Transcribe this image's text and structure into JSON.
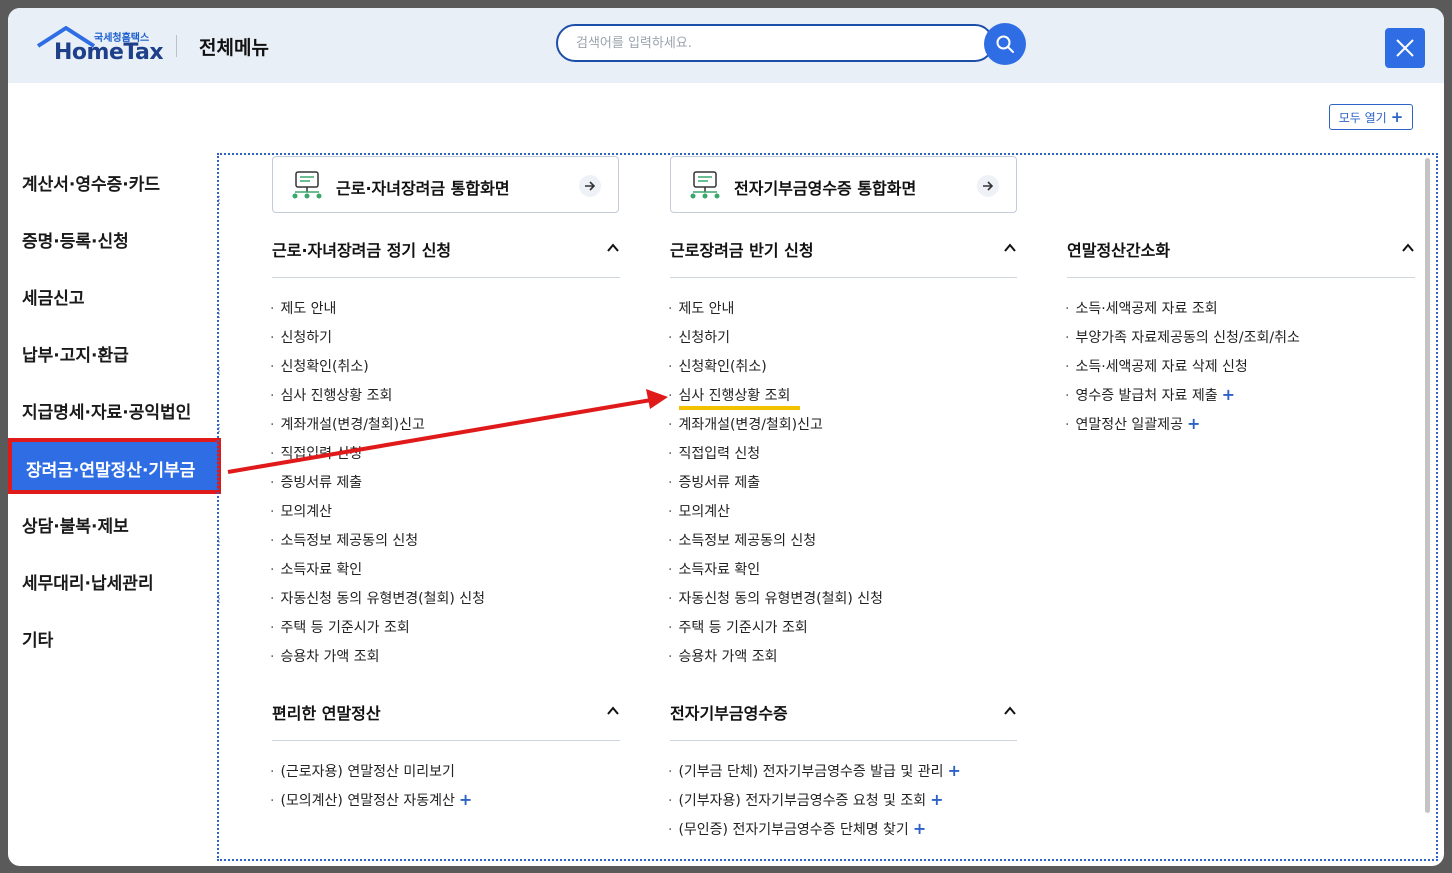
{
  "header": {
    "logo_sub": "국세청홈택스",
    "logo_main": "HomeTax",
    "title": "전체메뉴",
    "search_placeholder": "검색어를 입력하세요.",
    "expand_all_label": "모두 열기"
  },
  "sidebar": {
    "items": [
      {
        "label": "계산서·영수증·카드"
      },
      {
        "label": "증명·등록·신청"
      },
      {
        "label": "세금신고"
      },
      {
        "label": "납부·고지·환급"
      },
      {
        "label": "지급명세·자료·공익법인"
      },
      {
        "label": "장려금·연말정산·기부금",
        "active": true
      },
      {
        "label": "상담·불복·제보"
      },
      {
        "label": "세무대리·납세관리"
      },
      {
        "label": "기타"
      }
    ]
  },
  "cards": [
    {
      "label": "근로·자녀장려금 통합화면"
    },
    {
      "label": "전자기부금영수증 통합화면"
    }
  ],
  "sections": [
    {
      "title": "근로·자녀장려금 정기 신청",
      "links": [
        "제도 안내",
        "신청하기",
        "신청확인(취소)",
        "심사 진행상황 조회",
        "계좌개설(변경/철회)신고",
        "직접입력 신청",
        "증빙서류 제출",
        "모의계산",
        "소득정보 제공동의 신청",
        "소득자료 확인",
        "자동신청 동의 유형변경(철회) 신청",
        "주택 등 기준시가 조회",
        "승용차 가액 조회"
      ]
    },
    {
      "title": "근로장려금 반기 신청",
      "links": [
        "제도 안내",
        "신청하기",
        "신청확인(취소)",
        "심사 진행상황 조회",
        "계좌개설(변경/철회)신고",
        "직접입력 신청",
        "증빙서류 제출",
        "모의계산",
        "소득정보 제공동의 신청",
        "소득자료 확인",
        "자동신청 동의 유형변경(철회) 신청",
        "주택 등 기준시가 조회",
        "승용차 가액 조회"
      ]
    },
    {
      "title": "연말정산간소화",
      "links": [
        "소득·세액공제 자료 조회",
        "부양가족 자료제공동의 신청/조회/취소",
        "소득·세액공제 자료 삭제 신청",
        "영수증 발급처 자료 제출",
        "연말정산 일괄제공"
      ]
    },
    {
      "title": "편리한 연말정산",
      "links": [
        "(근로자용) 연말정산 미리보기",
        "(모의계산) 연말정산 자동계산"
      ]
    },
    {
      "title": "전자기부금영수증",
      "links": [
        "(기부금 단체) 전자기부금영수증 발급 및 관리",
        "(기부자용) 전자기부금영수증 요청 및 조회",
        "(무인증) 전자기부금영수증 단체명 찾기"
      ]
    }
  ],
  "colors": {
    "accent": "#2f6de5",
    "annotation_red": "#e01a1a",
    "highlight_yellow": "#f2c200"
  }
}
